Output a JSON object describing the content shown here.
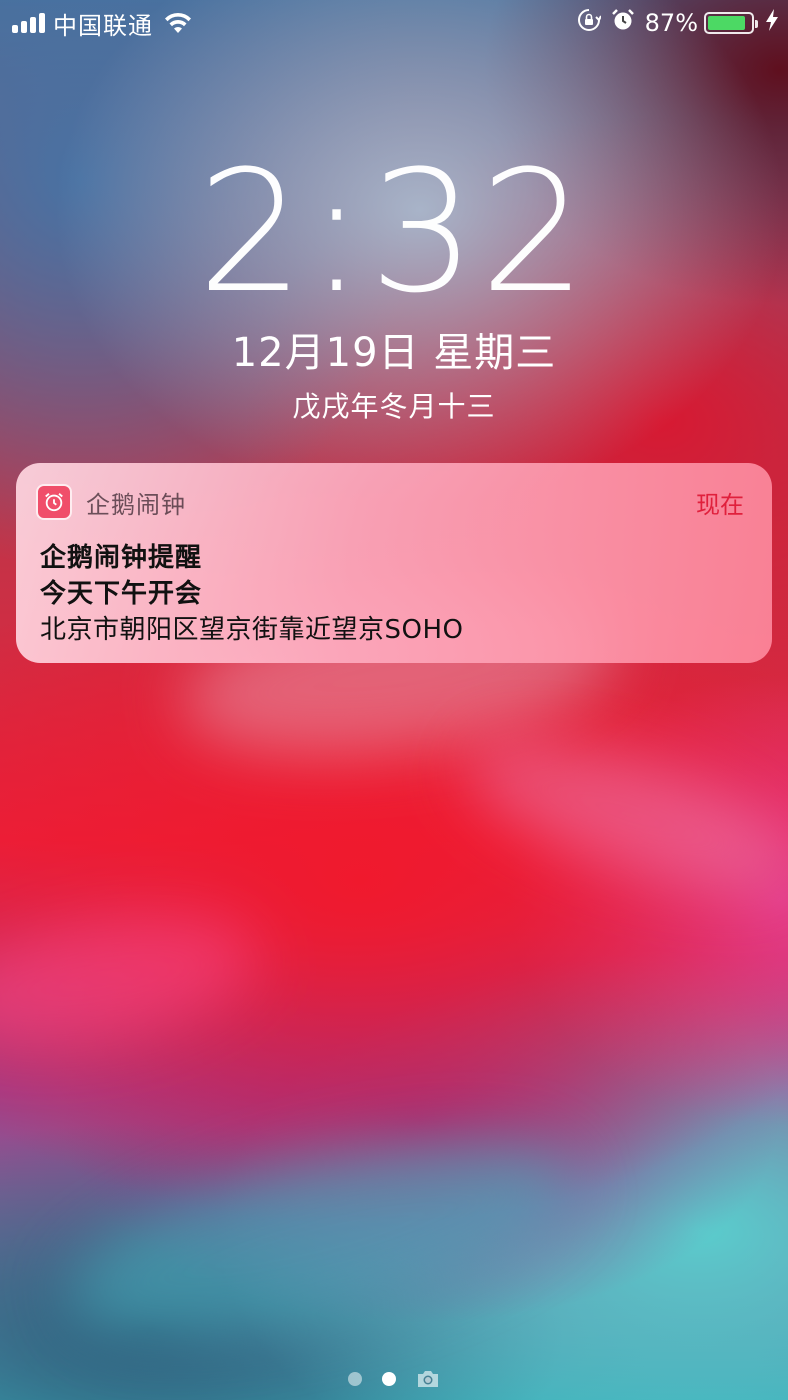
{
  "status_bar": {
    "carrier": "中国联通",
    "battery_percent": "87%",
    "battery_level": 0.87,
    "icons": [
      "signal-icon",
      "wifi-icon",
      "orientation-lock-icon",
      "alarm-icon",
      "battery-icon",
      "charging-icon"
    ]
  },
  "lock_screen": {
    "time": "2:32",
    "date": "12月19日 星期三",
    "lunar_date": "戊戌年冬月十三"
  },
  "notification": {
    "app_name": "企鹅闹钟",
    "time": "现在",
    "title": "企鹅闹钟提醒",
    "subtitle": "今天下午开会",
    "body": "北京市朝阳区望京街靠近望京SOHO",
    "app_icon": "alarm-clock-icon",
    "accent_color": "#e0203c"
  },
  "page_indicator": {
    "pages": 2,
    "active_page": 2,
    "camera_icon": "camera-icon"
  }
}
